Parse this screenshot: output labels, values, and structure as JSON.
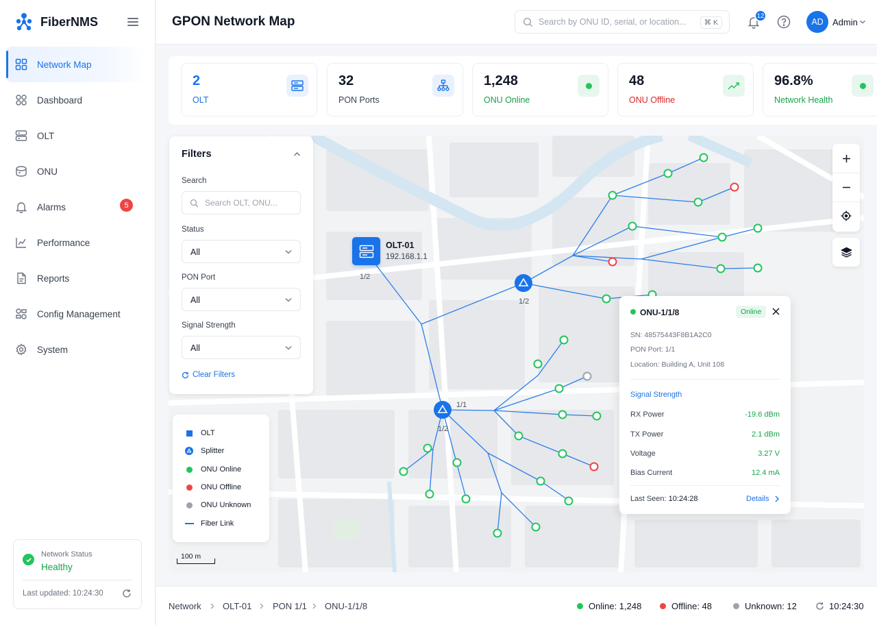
{
  "app": {
    "name": "FiberNMS"
  },
  "sidebar": {
    "items": [
      {
        "label": "Network Map",
        "icon": "network-map-icon",
        "active": true
      },
      {
        "label": "Dashboard",
        "icon": "dashboard-icon"
      },
      {
        "label": "OLT",
        "icon": "olt-icon"
      },
      {
        "label": "ONU",
        "icon": "onu-icon"
      },
      {
        "label": "Alarms",
        "icon": "bell-icon",
        "badge": "5"
      },
      {
        "label": "Performance",
        "icon": "chart-icon"
      },
      {
        "label": "Reports",
        "icon": "report-icon"
      },
      {
        "label": "Config Management",
        "icon": "config-icon"
      },
      {
        "label": "System",
        "icon": "gear-icon"
      }
    ],
    "network_status": {
      "label": "Network Status",
      "value": "Healthy",
      "updated": "Last updated: 10:24:30"
    }
  },
  "header": {
    "title": "GPON Network Map",
    "search_placeholder": "Search by ONU ID, serial, or location...",
    "shortcut": "⌘ K",
    "notifications": "12",
    "avatar_initials": "AD",
    "user": "Admin"
  },
  "stats": [
    {
      "value": "2",
      "label": "OLT",
      "label_color": "#1a73e8",
      "icon": "server-icon"
    },
    {
      "value": "32",
      "label": "PON Ports",
      "label_color": "#374151",
      "icon": "network-tree-icon"
    },
    {
      "value": "1,248",
      "label": "ONU Online",
      "label_color": "#16a34a",
      "icon": "status-dot-icon"
    },
    {
      "value": "48",
      "label": "ONU Offline",
      "label_color": "#dc2626",
      "icon": "trend-icon"
    },
    {
      "value": "96.8%",
      "label": "Network Health",
      "label_color": "#16a34a",
      "icon": "status-dot-icon"
    }
  ],
  "filters": {
    "title": "Filters",
    "search_label": "Search",
    "search_placeholder": "Search OLT, ONU...",
    "status_label": "Status",
    "status_value": "All",
    "pon_label": "PON Port",
    "pon_value": "All",
    "signal_label": "Signal Strength",
    "signal_value": "All",
    "clear": "Clear Filters"
  },
  "legend": {
    "olt": "OLT",
    "splitter": "Splitter",
    "online": "ONU Online",
    "offline": "ONU Offline",
    "unknown": "ONU Unknown",
    "fiber": "Fiber Link"
  },
  "map": {
    "scale": "100 m",
    "olt_name": "OLT-01",
    "olt_ip": "192.168.1.1",
    "olt_port_label": "1/2",
    "splitter1_label": "1/2",
    "splitter2_label": "1/2",
    "splitter2_side_label": "1/1"
  },
  "popup": {
    "title": "ONU-1/1/8",
    "status": "Online",
    "sn": "SN: 48575443F8B1A2C0",
    "pon": "PON Port: 1/1",
    "location": "Location: Building A, Unit 108",
    "signal_header": "Signal Strength",
    "rows": [
      {
        "label": "RX Power",
        "value": "-19.6 dBm"
      },
      {
        "label": "TX Power",
        "value": "2.1 dBm"
      },
      {
        "label": "Voltage",
        "value": "3.27 V"
      },
      {
        "label": "Bias Current",
        "value": "12.4 mA"
      }
    ],
    "last_seen_label": "Last Seen:",
    "last_seen": "10:24:28",
    "details": "Details"
  },
  "footer": {
    "breadcrumb": [
      "Network",
      "OLT-01",
      "PON 1/1",
      "ONU-1/1/8"
    ],
    "online": "Online: 1,248",
    "offline": "Offline: 48",
    "unknown": "Unknown: 12",
    "time": "10:24:30"
  },
  "colors": {
    "accent": "#1a73e8",
    "online": "#22c55e",
    "offline": "#ef4444",
    "unknown": "#9ca3af"
  }
}
